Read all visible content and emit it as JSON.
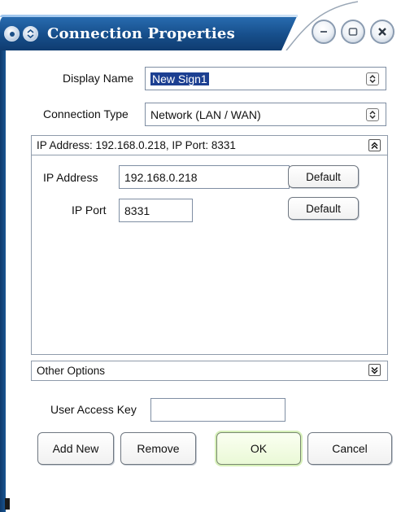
{
  "window": {
    "title": "Connection Properties"
  },
  "form": {
    "display_name_label": "Display Name",
    "display_name_value": "New Sign1",
    "connection_type_label": "Connection Type",
    "connection_type_value": "Network (LAN / WAN)"
  },
  "ip_group": {
    "header": "IP Address: 192.168.0.218, IP Port: 8331",
    "ip_address_label": "IP Address",
    "ip_address_value": "192.168.0.218",
    "ip_port_label": "IP Port",
    "ip_port_value": "8331",
    "default_label": "Default"
  },
  "other_group": {
    "header": "Other Options"
  },
  "access": {
    "label": "User Access Key",
    "value": ""
  },
  "buttons": {
    "add_new": "Add New",
    "remove": "Remove",
    "ok": "OK",
    "cancel": "Cancel"
  },
  "icons": {
    "system_menu": "dot-circle-icon",
    "dropdown_menu": "chevron-up-down-icon",
    "minimize": "minimize-icon",
    "maximize": "maximize-icon",
    "close": "close-icon",
    "collapse": "double-chevron-up-icon",
    "expand": "double-chevron-down-icon"
  },
  "colors": {
    "title_bar": "#174f8c",
    "selection": "#1c3f91",
    "ok_highlight": "#d6f0b8"
  }
}
